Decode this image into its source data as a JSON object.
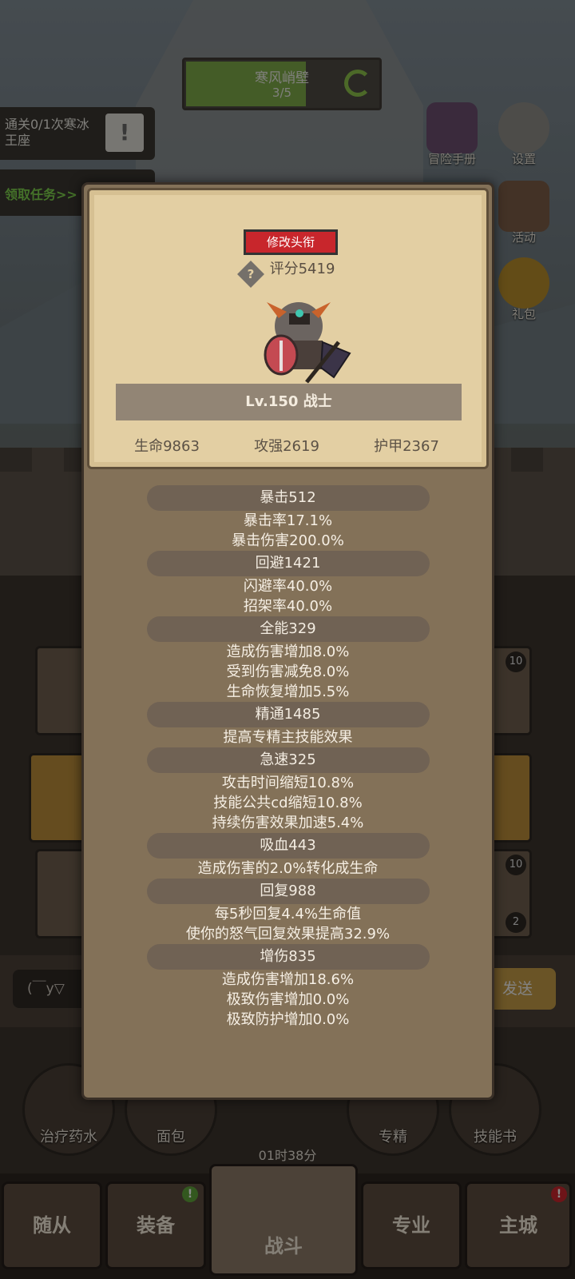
{
  "stage": {
    "name": "寒风峭壁",
    "progress": "3/5",
    "progress_fraction": 0.6
  },
  "quest": {
    "text": "通关0/1次寒冰王座",
    "button": "!"
  },
  "claim": {
    "label": "领取任务>>"
  },
  "side_buttons": [
    {
      "label": "冒险手册",
      "icon": "book-icon"
    },
    {
      "label": "设置",
      "icon": "gear-icon"
    },
    {
      "label": "活动",
      "icon": "calendar-icon"
    },
    {
      "label": "礼包",
      "icon": "gift-icon"
    }
  ],
  "chat": {
    "input": "(￣y▽",
    "send": "发送"
  },
  "consumables": [
    "治疗药水",
    "面包",
    "专精",
    "技能书"
  ],
  "timer": "01时38分",
  "nav": [
    "随从",
    "装备",
    "战斗",
    "专业",
    "主城"
  ],
  "skill_badges": [
    "10",
    "10",
    "2"
  ],
  "modal": {
    "title_button": "修改头衔",
    "score_icon": "?",
    "score": "评分5419",
    "level": "Lv.150 战士",
    "stats": [
      "生命9863",
      "攻强2619",
      "护甲2367"
    ],
    "attributes": [
      {
        "head": "暴击512",
        "lines": [
          "暴击率17.1%",
          "暴击伤害200.0%"
        ]
      },
      {
        "head": "回避1421",
        "lines": [
          "闪避率40.0%",
          "招架率40.0%"
        ]
      },
      {
        "head": "全能329",
        "lines": [
          "造成伤害增加8.0%",
          "受到伤害减免8.0%",
          "生命恢复增加5.5%"
        ]
      },
      {
        "head": "精通1485",
        "lines": [
          "提高专精主技能效果"
        ]
      },
      {
        "head": "急速325",
        "lines": [
          "攻击时间缩短10.8%",
          "技能公共cd缩短10.8%",
          "持续伤害效果加速5.4%"
        ]
      },
      {
        "head": "吸血443",
        "lines": [
          "造成伤害的2.0%转化成生命"
        ]
      },
      {
        "head": "回复988",
        "lines": [
          "每5秒回复4.4%生命值",
          "使你的怒气回复效果提高32.9%"
        ]
      },
      {
        "head": "增伤835",
        "lines": [
          "造成伤害增加18.6%",
          "极致伤害增加0.0%",
          "极致防护增加0.0%"
        ]
      }
    ]
  },
  "colors": {
    "accent_red": "#c8262c",
    "parchment": "#e3cfa3",
    "claim_green": "#7ccf4c"
  }
}
